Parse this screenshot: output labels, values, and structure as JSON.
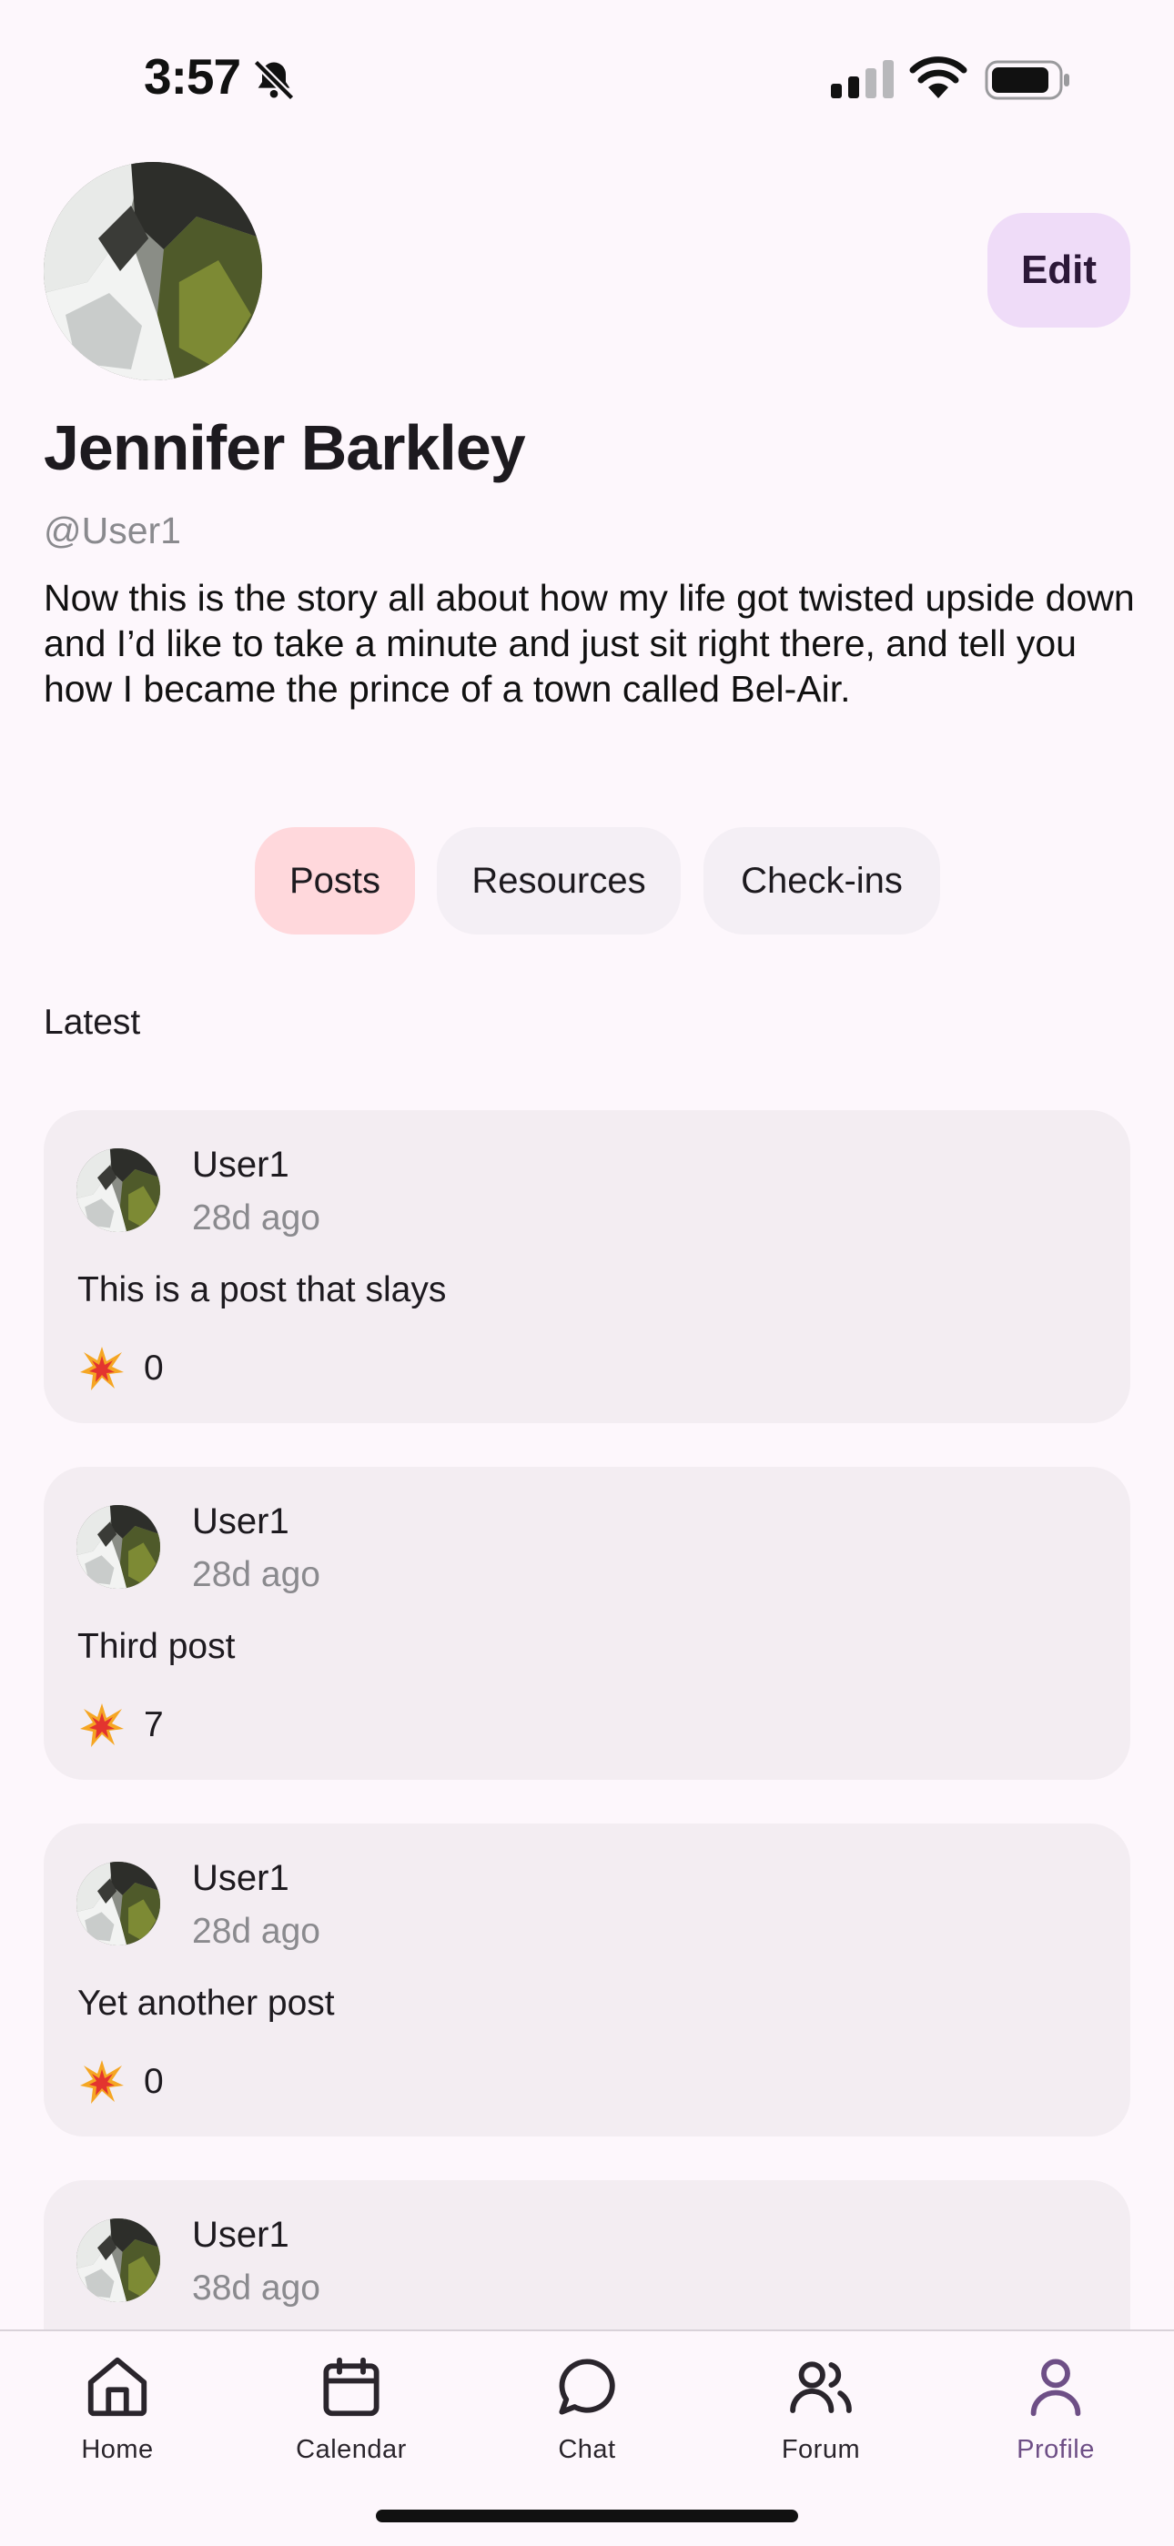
{
  "status_bar": {
    "time": "3:57",
    "icons": [
      "bell-slash-icon",
      "cellular-signal-icon",
      "wifi-icon",
      "battery-icon"
    ]
  },
  "profile": {
    "name": "Jennifer Barkley",
    "handle": "@User1",
    "bio": "Now this is the story all about how my life got twisted upside down and I’d like to take a minute and just sit right there, and tell you how I became the prince of a town called Bel-Air.",
    "edit_label": "Edit"
  },
  "tabs": [
    {
      "label": "Posts",
      "active": true
    },
    {
      "label": "Resources",
      "active": false
    },
    {
      "label": "Check-ins",
      "active": false
    }
  ],
  "section_label": "Latest",
  "posts": [
    {
      "user": "User1",
      "time": "28d ago",
      "text": "This is a post that slays",
      "reaction_icon": "explosion-emoji-icon",
      "count": "0"
    },
    {
      "user": "User1",
      "time": "28d ago",
      "text": "Third post",
      "reaction_icon": "explosion-emoji-icon",
      "count": "7"
    },
    {
      "user": "User1",
      "time": "28d ago",
      "text": "Yet another post",
      "reaction_icon": "explosion-emoji-icon",
      "count": "0"
    },
    {
      "user": "User1",
      "time": "38d ago",
      "text": "",
      "reaction_icon": "explosion-emoji-icon",
      "count": ""
    }
  ],
  "nav": [
    {
      "label": "Home",
      "icon": "home-icon",
      "active": false
    },
    {
      "label": "Calendar",
      "icon": "calendar-icon",
      "active": false
    },
    {
      "label": "Chat",
      "icon": "chat-bubble-icon",
      "active": false
    },
    {
      "label": "Forum",
      "icon": "people-icon",
      "active": false
    },
    {
      "label": "Profile",
      "icon": "person-icon",
      "active": true
    }
  ],
  "colors": {
    "background": "#fdf7fc",
    "edit_button": "#efdcf8",
    "active_tab": "#ffd8dc",
    "card": "#f3edf2",
    "active_nav": "#6e4f86"
  }
}
